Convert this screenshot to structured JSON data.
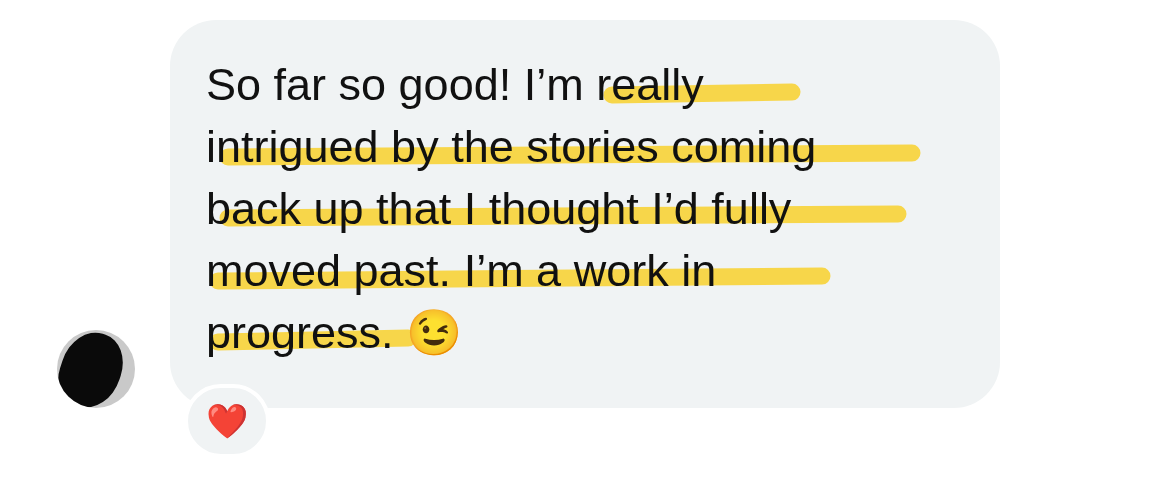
{
  "message": {
    "lines": [
      "So far so good! I’m really",
      "intrigued by the stories coming",
      "back up that I thought I’d fully",
      "moved past. I’m a work in",
      "progress. 😉"
    ]
  },
  "reaction": {
    "emoji": "❤️"
  }
}
